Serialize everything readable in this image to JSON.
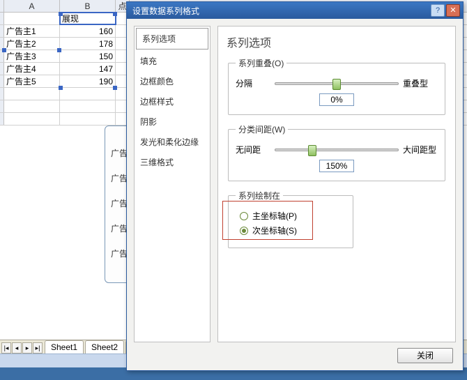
{
  "spreadsheet": {
    "col_headers": [
      "A",
      "B",
      "点"
    ],
    "header_row": {
      "b": "展现"
    },
    "rows": [
      {
        "a": "广告主1",
        "b": "160"
      },
      {
        "a": "广告主2",
        "b": "178"
      },
      {
        "a": "广告主3",
        "b": "150"
      },
      {
        "a": "广告主4",
        "b": "147"
      },
      {
        "a": "广告主5",
        "b": "190"
      }
    ],
    "chart_legend_prefix": "广告",
    "tabs": [
      "Sheet1",
      "Sheet2",
      "Shee"
    ]
  },
  "dialog": {
    "title": "设置数据系列格式",
    "categories": [
      "系列选项",
      "填充",
      "边框颜色",
      "边框样式",
      "阴影",
      "发光和柔化边缘",
      "三维格式"
    ],
    "selected_category_index": 0,
    "pane_title": "系列选项",
    "group_overlap": {
      "legend": "系列重叠(O)",
      "left": "分隔",
      "right": "重叠型",
      "value": "0%",
      "thumb_pct": 50
    },
    "group_gap": {
      "legend": "分类间距(W)",
      "left": "无间距",
      "right": "大间距型",
      "value": "150%",
      "thumb_pct": 30
    },
    "group_axis": {
      "legend": "系列绘制在",
      "primary": "主坐标轴(P)",
      "secondary": "次坐标轴(S)",
      "selected": "secondary"
    },
    "close_label": "关闭"
  }
}
